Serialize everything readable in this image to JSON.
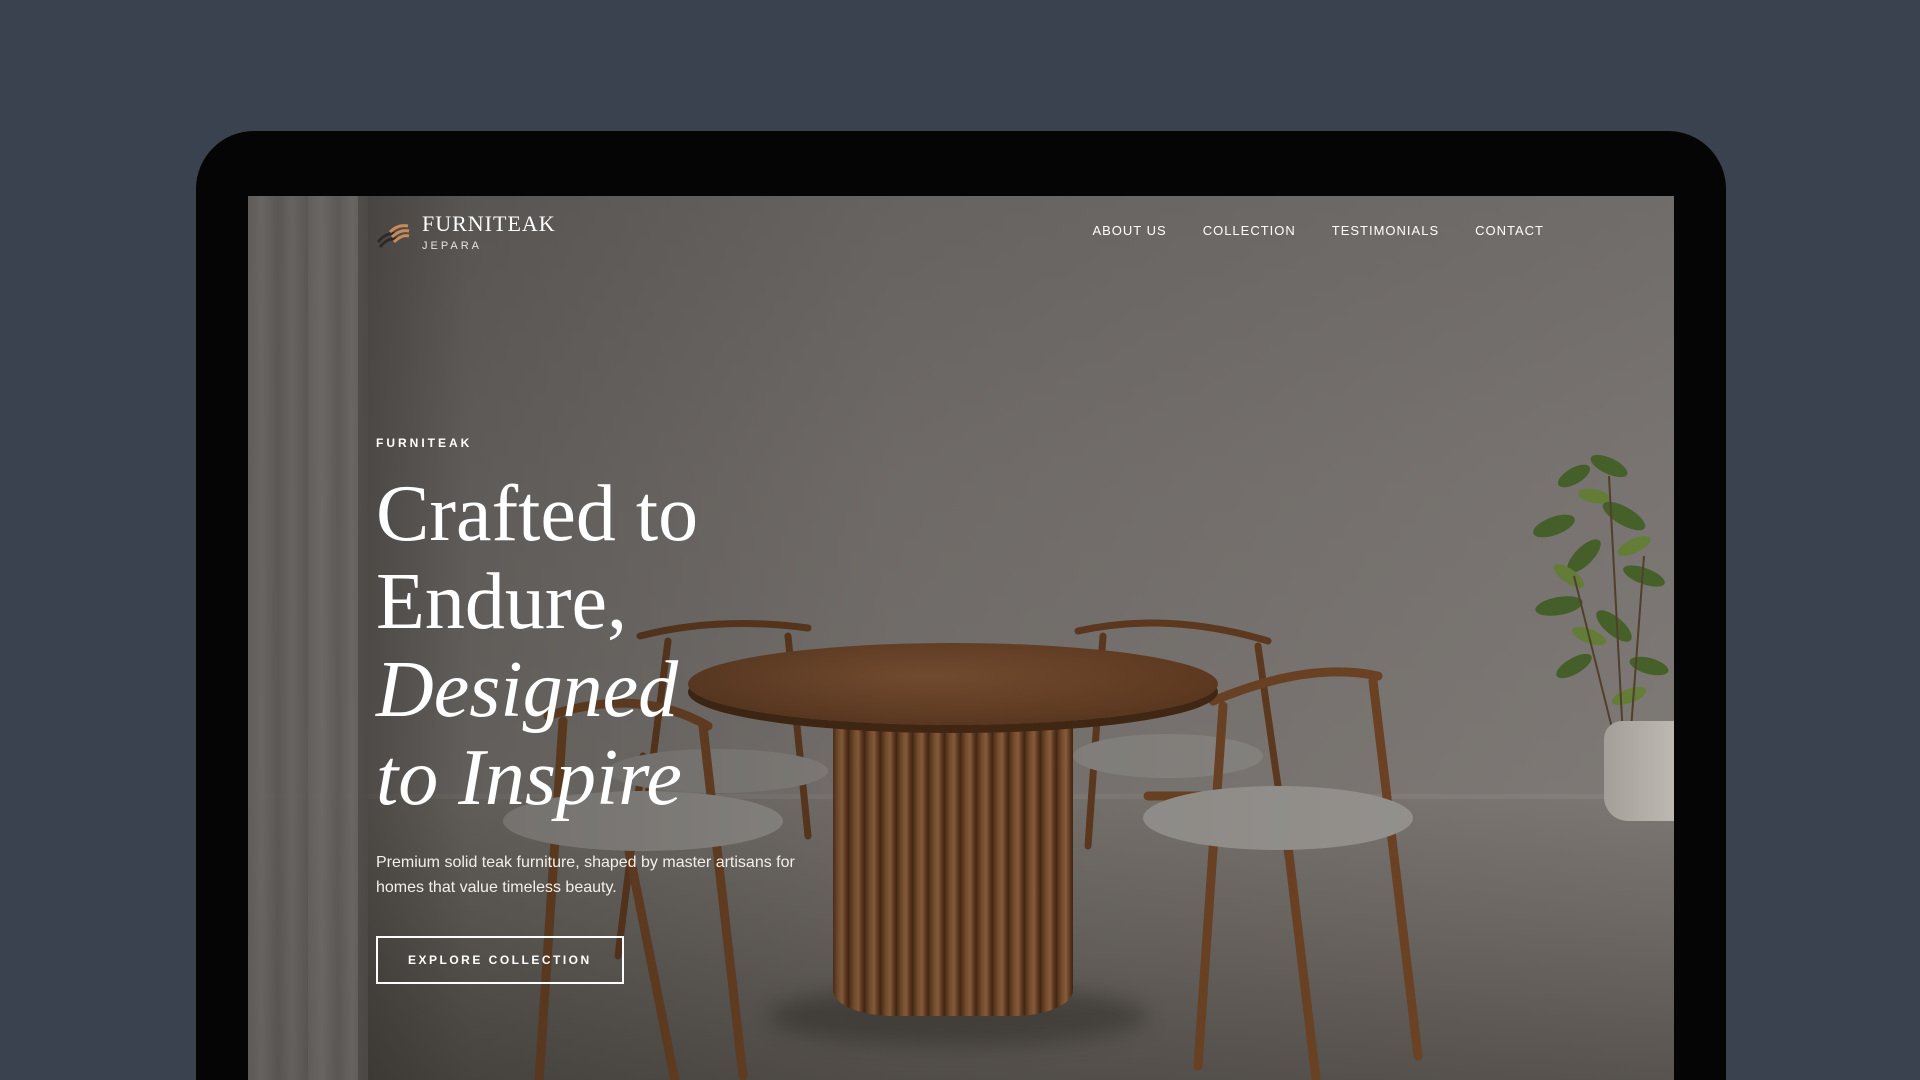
{
  "brand": {
    "name": "FURNITEAK",
    "location": "JEPARA"
  },
  "nav": {
    "links": [
      "ABOUT US",
      "COLLECTION",
      "TESTIMONIALS",
      "CONTACT"
    ]
  },
  "hero": {
    "eyebrow": "FURNITEAK",
    "headline_line1": "Crafted to",
    "headline_line2": "Endure,",
    "headline_line3": "Designed",
    "headline_line4": "to Inspire",
    "subtext": "Premium solid teak furniture, shaped by master artisans for homes that value timeless beauty.",
    "cta_label": "EXPLORE COLLECTION"
  },
  "colors": {
    "page_bg": "#3a424f",
    "bezel": "#050505",
    "text": "#ffffff",
    "accent_wood": "#8a5a37"
  },
  "icons": [
    "brand-logo-mark-icon"
  ]
}
